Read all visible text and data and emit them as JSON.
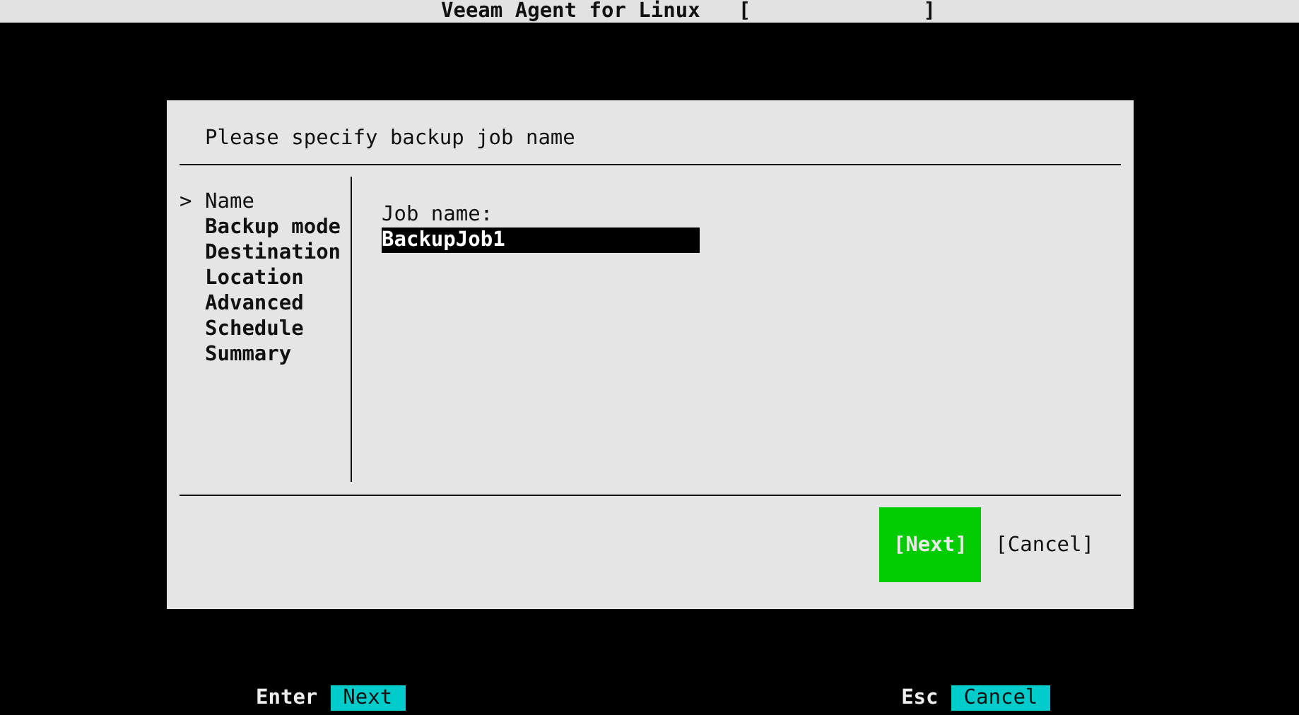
{
  "header": {
    "title": "Veeam Agent for Linux",
    "indicator": "[              ]"
  },
  "dialog": {
    "title": "Please specify backup job name",
    "steps": [
      {
        "label": "Name",
        "selected": true
      },
      {
        "label": "Backup mode",
        "selected": false
      },
      {
        "label": "Destination",
        "selected": false
      },
      {
        "label": "Location",
        "selected": false
      },
      {
        "label": "Advanced",
        "selected": false
      },
      {
        "label": "Schedule",
        "selected": false
      },
      {
        "label": "Summary",
        "selected": false
      }
    ],
    "cursor": ">",
    "field": {
      "label": "Job name:",
      "value": "BackupJob1"
    },
    "buttons": [
      {
        "label": "[Next]",
        "focused": true
      },
      {
        "label": "[Cancel]",
        "focused": false
      }
    ]
  },
  "hotkeys": [
    {
      "key": "Enter",
      "action": "Next"
    },
    {
      "key": "Esc",
      "action": "Cancel"
    }
  ]
}
